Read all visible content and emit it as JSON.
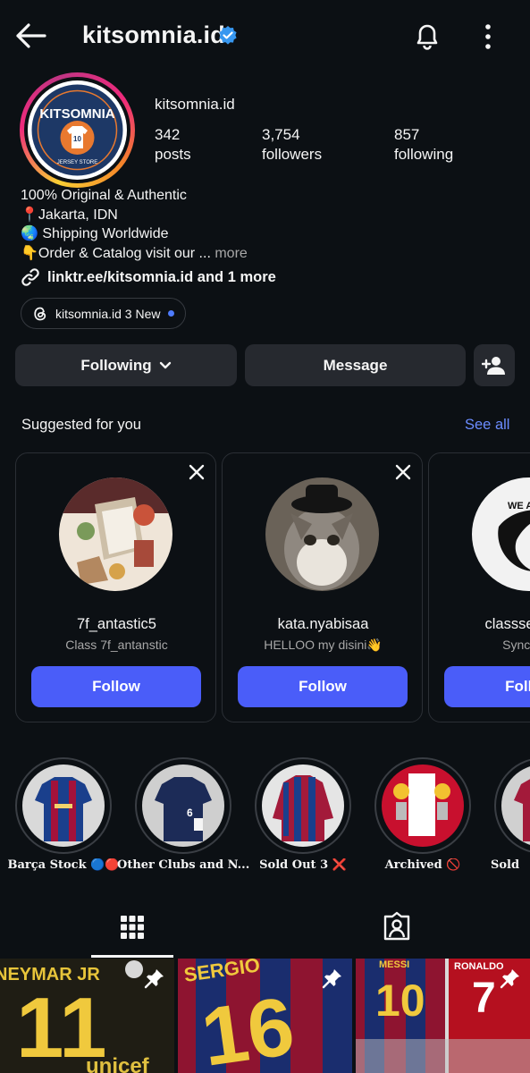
{
  "header": {
    "username": "kitsomnia.id"
  },
  "profile": {
    "name": "kitsomnia.id",
    "stats": [
      {
        "value": "342",
        "label": "posts"
      },
      {
        "value": "3,754",
        "label": "followers"
      },
      {
        "value": "857",
        "label": "following"
      }
    ],
    "avatar_text": {
      "brand": "KITSOMNIA",
      "sub": "JERSEY STORE",
      "number": "10"
    },
    "bio": [
      "100% Original & Authentic",
      "📍Jakarta, IDN",
      "🌏 Shipping Worldwide",
      "👇Order & Catalog visit our ..."
    ],
    "bio_more": "more",
    "link": "linktr.ee/kitsomnia.id and 1 more",
    "threads_pill": "kitsomnia.id 3 New"
  },
  "actions": {
    "following_label": "Following",
    "message_label": "Message"
  },
  "suggested": {
    "title": "Suggested for you",
    "see_all": "See all",
    "cards": [
      {
        "username": "7f_antastic5",
        "subtitle": "Class 7f_antanstic",
        "follow": "Follow"
      },
      {
        "username": "kata.nyabisaa",
        "subtitle": "HELLOO my disini👋",
        "follow": "Follow"
      },
      {
        "username": "classsevenon",
        "subtitle": "Syncee.N",
        "follow": "Follow"
      }
    ]
  },
  "highlights": [
    {
      "label": "Barça Stock 🔵🔴"
    },
    {
      "label": "Other Clubs and N..."
    },
    {
      "label": "Sold Out 3 ❌"
    },
    {
      "label": "Archived 🚫"
    },
    {
      "label": "Sold"
    }
  ],
  "posts": [
    {
      "jersey_name": "NEYMAR JR",
      "number": "11",
      "sponsor": "unicef"
    },
    {
      "jersey_name": "SERGIO",
      "number": "16"
    },
    {
      "jersey_name": "MESSI",
      "number": "10",
      "second_name": "RONALDO",
      "second_number": "7"
    }
  ],
  "colors": {
    "background": "#0c1014",
    "button": "#26292f",
    "follow": "#4a5df9",
    "link": "#6b8cff",
    "verified": "#3797f0"
  },
  "icons": [
    "back-arrow-icon",
    "verified-icon",
    "bell-icon",
    "more-vertical-icon",
    "link-icon",
    "threads-icon",
    "chevron-down-icon",
    "add-user-icon",
    "close-icon",
    "grid-icon",
    "tagged-icon",
    "pin-icon"
  ]
}
